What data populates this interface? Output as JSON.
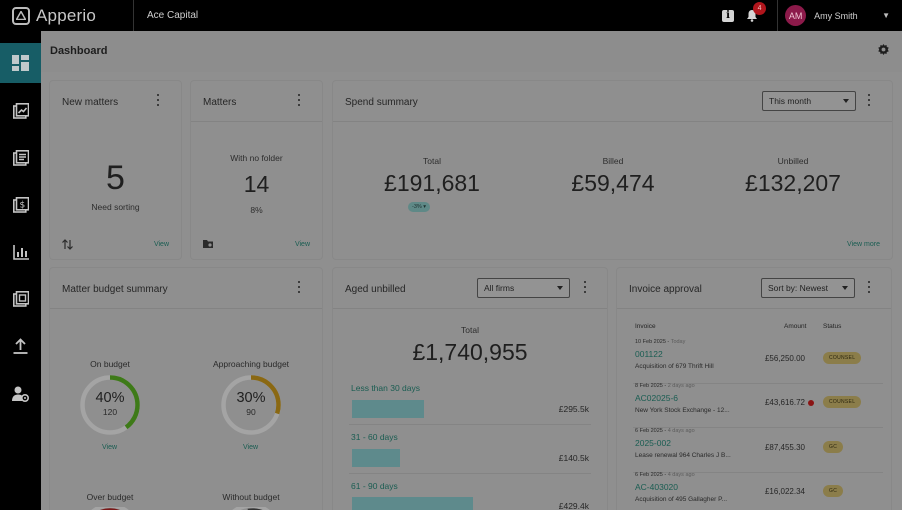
{
  "app": {
    "name": "Apperio",
    "company": "Ace Capital"
  },
  "topbar": {
    "notifications_count": "4",
    "user_initials": "AM",
    "user_name": "Amy Smith"
  },
  "sidebar": {
    "items": [
      {
        "name": "dashboard",
        "icon": "dashboard-icon",
        "active": true
      },
      {
        "name": "matters",
        "icon": "trending-icon",
        "active": false
      },
      {
        "name": "documents",
        "icon": "documents-icon",
        "active": false
      },
      {
        "name": "invoices",
        "icon": "invoice-icon",
        "active": false
      },
      {
        "name": "reports",
        "icon": "chart-icon",
        "active": false
      },
      {
        "name": "copy",
        "icon": "copy-icon",
        "active": false
      },
      {
        "name": "upload",
        "icon": "upload-icon",
        "active": false
      },
      {
        "name": "users",
        "icon": "user-settings-icon",
        "active": false
      }
    ]
  },
  "header": {
    "title": "Dashboard"
  },
  "new_matters": {
    "title": "New matters",
    "count": "5",
    "caption": "Need sorting",
    "link": "View"
  },
  "matters": {
    "title": "Matters",
    "subtitle": "With no folder",
    "count": "14",
    "pct": "8%",
    "link": "View"
  },
  "spend": {
    "title": "Spend summary",
    "period": "This month",
    "total_label": "Total",
    "total": "£191,681",
    "change": "-3%",
    "billed_label": "Billed",
    "billed": "£59,474",
    "unbilled_label": "Unbilled",
    "unbilled": "£132,207",
    "link": "View more"
  },
  "budget": {
    "title": "Matter budget summary",
    "items": [
      {
        "label": "On budget",
        "pct": "40%",
        "count": "120",
        "link": "View",
        "fraction": 0.4,
        "color": "#3e7a18"
      },
      {
        "label": "Approaching budget",
        "pct": "30%",
        "count": "90",
        "link": "View",
        "fraction": 0.3,
        "color": "#8a6812"
      }
    ],
    "more_labels": [
      "Over budget",
      "Without budget"
    ]
  },
  "aged": {
    "title": "Aged unbilled",
    "filter": "All firms",
    "total_label": "Total",
    "total": "£1,740,955",
    "buckets": [
      {
        "label": "Less than 30 days",
        "value": "£295.5k",
        "fraction": 0.41
      },
      {
        "label": "31 - 60 days",
        "value": "£140.5k",
        "fraction": 0.27
      },
      {
        "label": "61 - 90 days",
        "value": "£429.4k",
        "fraction": 0.69
      }
    ]
  },
  "invoices": {
    "title": "Invoice approval",
    "sort": "Sort by: Newest",
    "headers": {
      "invoice": "Invoice",
      "amount": "Amount",
      "status": "Status"
    },
    "rows": [
      {
        "date": "10 Feb 2025",
        "ago": "Today",
        "id": "001122",
        "desc": "Acquisition of 679 Thrift Hill",
        "amount": "£56,250.00",
        "status": "COUNSEL",
        "warn": false
      },
      {
        "date": "8 Feb 2025",
        "ago": "2 days ago",
        "id": "AC02025-6",
        "desc": "New York Stock Exchange - 12...",
        "amount": "£43,616.72",
        "status": "COUNSEL",
        "warn": true
      },
      {
        "date": "6 Feb 2025",
        "ago": "4 days ago",
        "id": "2025-002",
        "desc": "Lease renewal 964 Charles J B...",
        "amount": "£87,455.30",
        "status": "GC",
        "warn": false
      },
      {
        "date": "6 Feb 2025",
        "ago": "4 days ago",
        "id": "AC-403020",
        "desc": "Acquisition of 495 Gallagher P...",
        "amount": "£16,022.34",
        "status": "GC",
        "warn": false
      }
    ]
  }
}
